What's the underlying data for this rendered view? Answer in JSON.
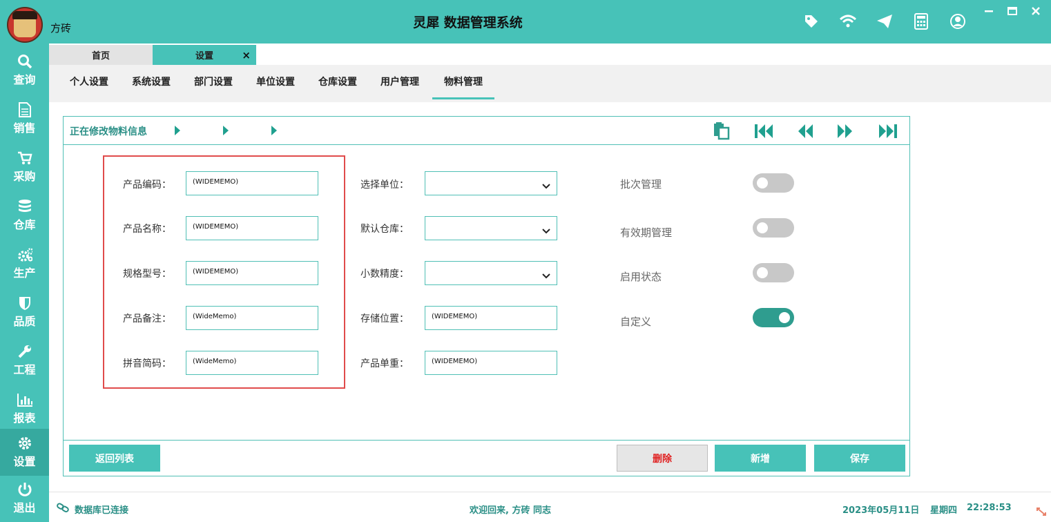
{
  "titlebar": {
    "username": "方砖",
    "title": "灵犀 数据管理系统",
    "icons": [
      "tag-icon",
      "wifi-icon",
      "send-icon",
      "calculator-icon",
      "user-icon"
    ],
    "window_controls": [
      "minimize-icon",
      "maximize-icon",
      "close-icon"
    ]
  },
  "sidebar": {
    "items": [
      {
        "label": "查询",
        "icon": "search-icon"
      },
      {
        "label": "销售",
        "icon": "document-icon"
      },
      {
        "label": "采购",
        "icon": "cart-icon"
      },
      {
        "label": "仓库",
        "icon": "database-icon"
      },
      {
        "label": "生产",
        "icon": "gears-icon"
      },
      {
        "label": "品质",
        "icon": "shield-icon"
      },
      {
        "label": "工程",
        "icon": "wrench-icon"
      },
      {
        "label": "报表",
        "icon": "bar-chart-icon"
      },
      {
        "label": "设置",
        "icon": "gear-icon",
        "active": true
      },
      {
        "label": "退出",
        "icon": "power-icon"
      }
    ]
  },
  "tabs": [
    {
      "label": "首页"
    },
    {
      "label": "设置",
      "active": true,
      "close": "×"
    }
  ],
  "subnav": {
    "items": [
      "个人设置",
      "系统设置",
      "部门设置",
      "单位设置",
      "仓库设置",
      "用户管理",
      "物料管理"
    ],
    "active": "物料管理"
  },
  "panel": {
    "title": "正在修改物料信息",
    "nav_buttons": [
      "copy-icon",
      "first-icon",
      "prev-icon",
      "next-icon",
      "last-icon"
    ],
    "left_fields": [
      {
        "label": "产品编码：",
        "value": "(WIDEMEMO)"
      },
      {
        "label": "产品名称：",
        "value": "(WIDEMEMO)"
      },
      {
        "label": "规格型号：",
        "value": "(WIDEMEMO)"
      },
      {
        "label": "产品备注：",
        "value": "(WideMemo)"
      },
      {
        "label": "拼音简码：",
        "value": "(WideMemo)"
      }
    ],
    "mid_fields": [
      {
        "label": "选择单位：",
        "type": "select",
        "value": ""
      },
      {
        "label": "默认仓库：",
        "type": "select",
        "value": ""
      },
      {
        "label": "小数精度：",
        "type": "select",
        "value": ""
      },
      {
        "label": "存储位置：",
        "type": "input",
        "value": "(WIDEMEMO)"
      },
      {
        "label": "产品单重：",
        "type": "input",
        "value": "(WIDEMEMO)"
      }
    ],
    "toggles": [
      {
        "label": "批次管理",
        "on": false
      },
      {
        "label": "有效期管理",
        "on": false
      },
      {
        "label": "启用状态",
        "on": false
      },
      {
        "label": "自定义",
        "on": true
      }
    ],
    "buttons": {
      "back": "返回列表",
      "delete": "删除",
      "add": "新增",
      "save": "保存"
    }
  },
  "statusbar": {
    "db_status": "数据库已连接",
    "welcome": "欢迎回来, 方砖 同志",
    "date": "2023年05月11日",
    "weekday": "星期四",
    "time": "22:28:53"
  },
  "colors": {
    "accent": "#47c2b8",
    "dark_accent": "#2f9d8f",
    "highlight_box": "#e04a4a",
    "delete_text": "#e02222"
  }
}
